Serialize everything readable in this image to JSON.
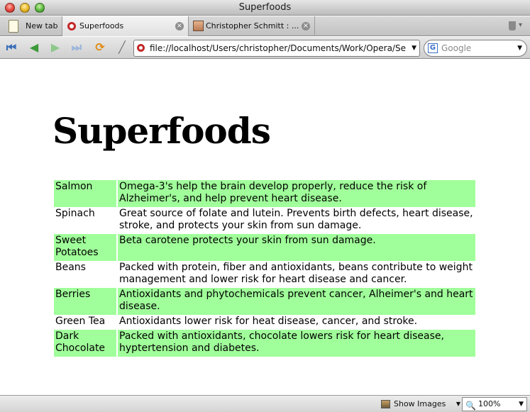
{
  "window": {
    "title": "Superfoods"
  },
  "tabs": {
    "new_tab_label": "New tab",
    "items": [
      {
        "label": "Superfoods"
      },
      {
        "label": "Christopher Schmitt : ..."
      }
    ]
  },
  "toolbar": {
    "address": "file://localhost/Users/christopher/Documents/Work/Opera/Se",
    "search_placeholder": "Google"
  },
  "page": {
    "heading": "Superfoods",
    "foods": [
      {
        "name": "Salmon",
        "benefit": "Omega-3's help the brain develop properly, reduce the risk of Alzheimer's, and help prevent heart disease.",
        "highlighted": true
      },
      {
        "name": "Spinach",
        "benefit": "Great source of folate and lutein. Prevents birth defects, heart disease, stroke, and protects your skin from sun damage.",
        "highlighted": false
      },
      {
        "name": "Sweet Potatoes",
        "benefit": "Beta carotene protects your skin from sun damage.",
        "highlighted": true
      },
      {
        "name": "Beans",
        "benefit": "Packed with protein, fiber and antioxidants, beans contribute to weight management and lower risk for heart disease and cancer.",
        "highlighted": false
      },
      {
        "name": "Berries",
        "benefit": "Antioxidants and phytochemicals prevent cancer, Alheimer's and heart disease.",
        "highlighted": true
      },
      {
        "name": "Green Tea",
        "benefit": "Antioxidants lower risk for heat disease, cancer, and stroke.",
        "highlighted": false
      },
      {
        "name": "Dark Chocolate",
        "benefit": "Packed with antioxidants, chocolate lowers risk for heart disease, hyptertension and diabetes.",
        "highlighted": true
      }
    ]
  },
  "statusbar": {
    "show_images_label": "Show Images",
    "zoom_value": "100%"
  },
  "colors": {
    "highlight_row": "#a0ff9a"
  }
}
